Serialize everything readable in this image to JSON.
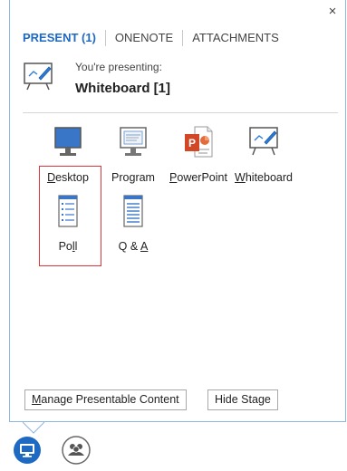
{
  "window": {
    "close_glyph": "×"
  },
  "tabs": [
    {
      "label": "PRESENT (1)",
      "active": true
    },
    {
      "label": "ONENOTE",
      "active": false
    },
    {
      "label": "ATTACHMENTS",
      "active": false
    }
  ],
  "presenting": {
    "subtitle": "You're presenting:",
    "title": "Whiteboard [1]",
    "icon": "whiteboard-icon"
  },
  "tiles": [
    {
      "icon": "desktop-icon",
      "pre": "",
      "u": "D",
      "post": "esktop"
    },
    {
      "icon": "program-icon",
      "pre": "Pro",
      "u": "g",
      "post": "ram"
    },
    {
      "icon": "powerpoint-icon",
      "pre": "",
      "u": "P",
      "post": "owerPoint"
    },
    {
      "icon": "whiteboard-icon",
      "pre": "",
      "u": "W",
      "post": "hiteboard"
    },
    {
      "icon": "poll-icon",
      "pre": "Po",
      "u": "l",
      "post": "l"
    },
    {
      "icon": "qa-icon",
      "pre": "Q & ",
      "u": "A",
      "post": ""
    }
  ],
  "buttons": {
    "manage": {
      "pre": "",
      "u": "M",
      "post": "anage Presentable Content"
    },
    "hide": {
      "pre": "Hide Sta",
      "u": "g",
      "post": "e"
    }
  },
  "taskbar": [
    {
      "icon": "present-icon",
      "active": true
    },
    {
      "icon": "participants-icon",
      "active": false
    }
  ],
  "colors": {
    "accent": "#1e6ac2",
    "highlight": "#e0353b",
    "panel_border": "#8fb6dd"
  }
}
